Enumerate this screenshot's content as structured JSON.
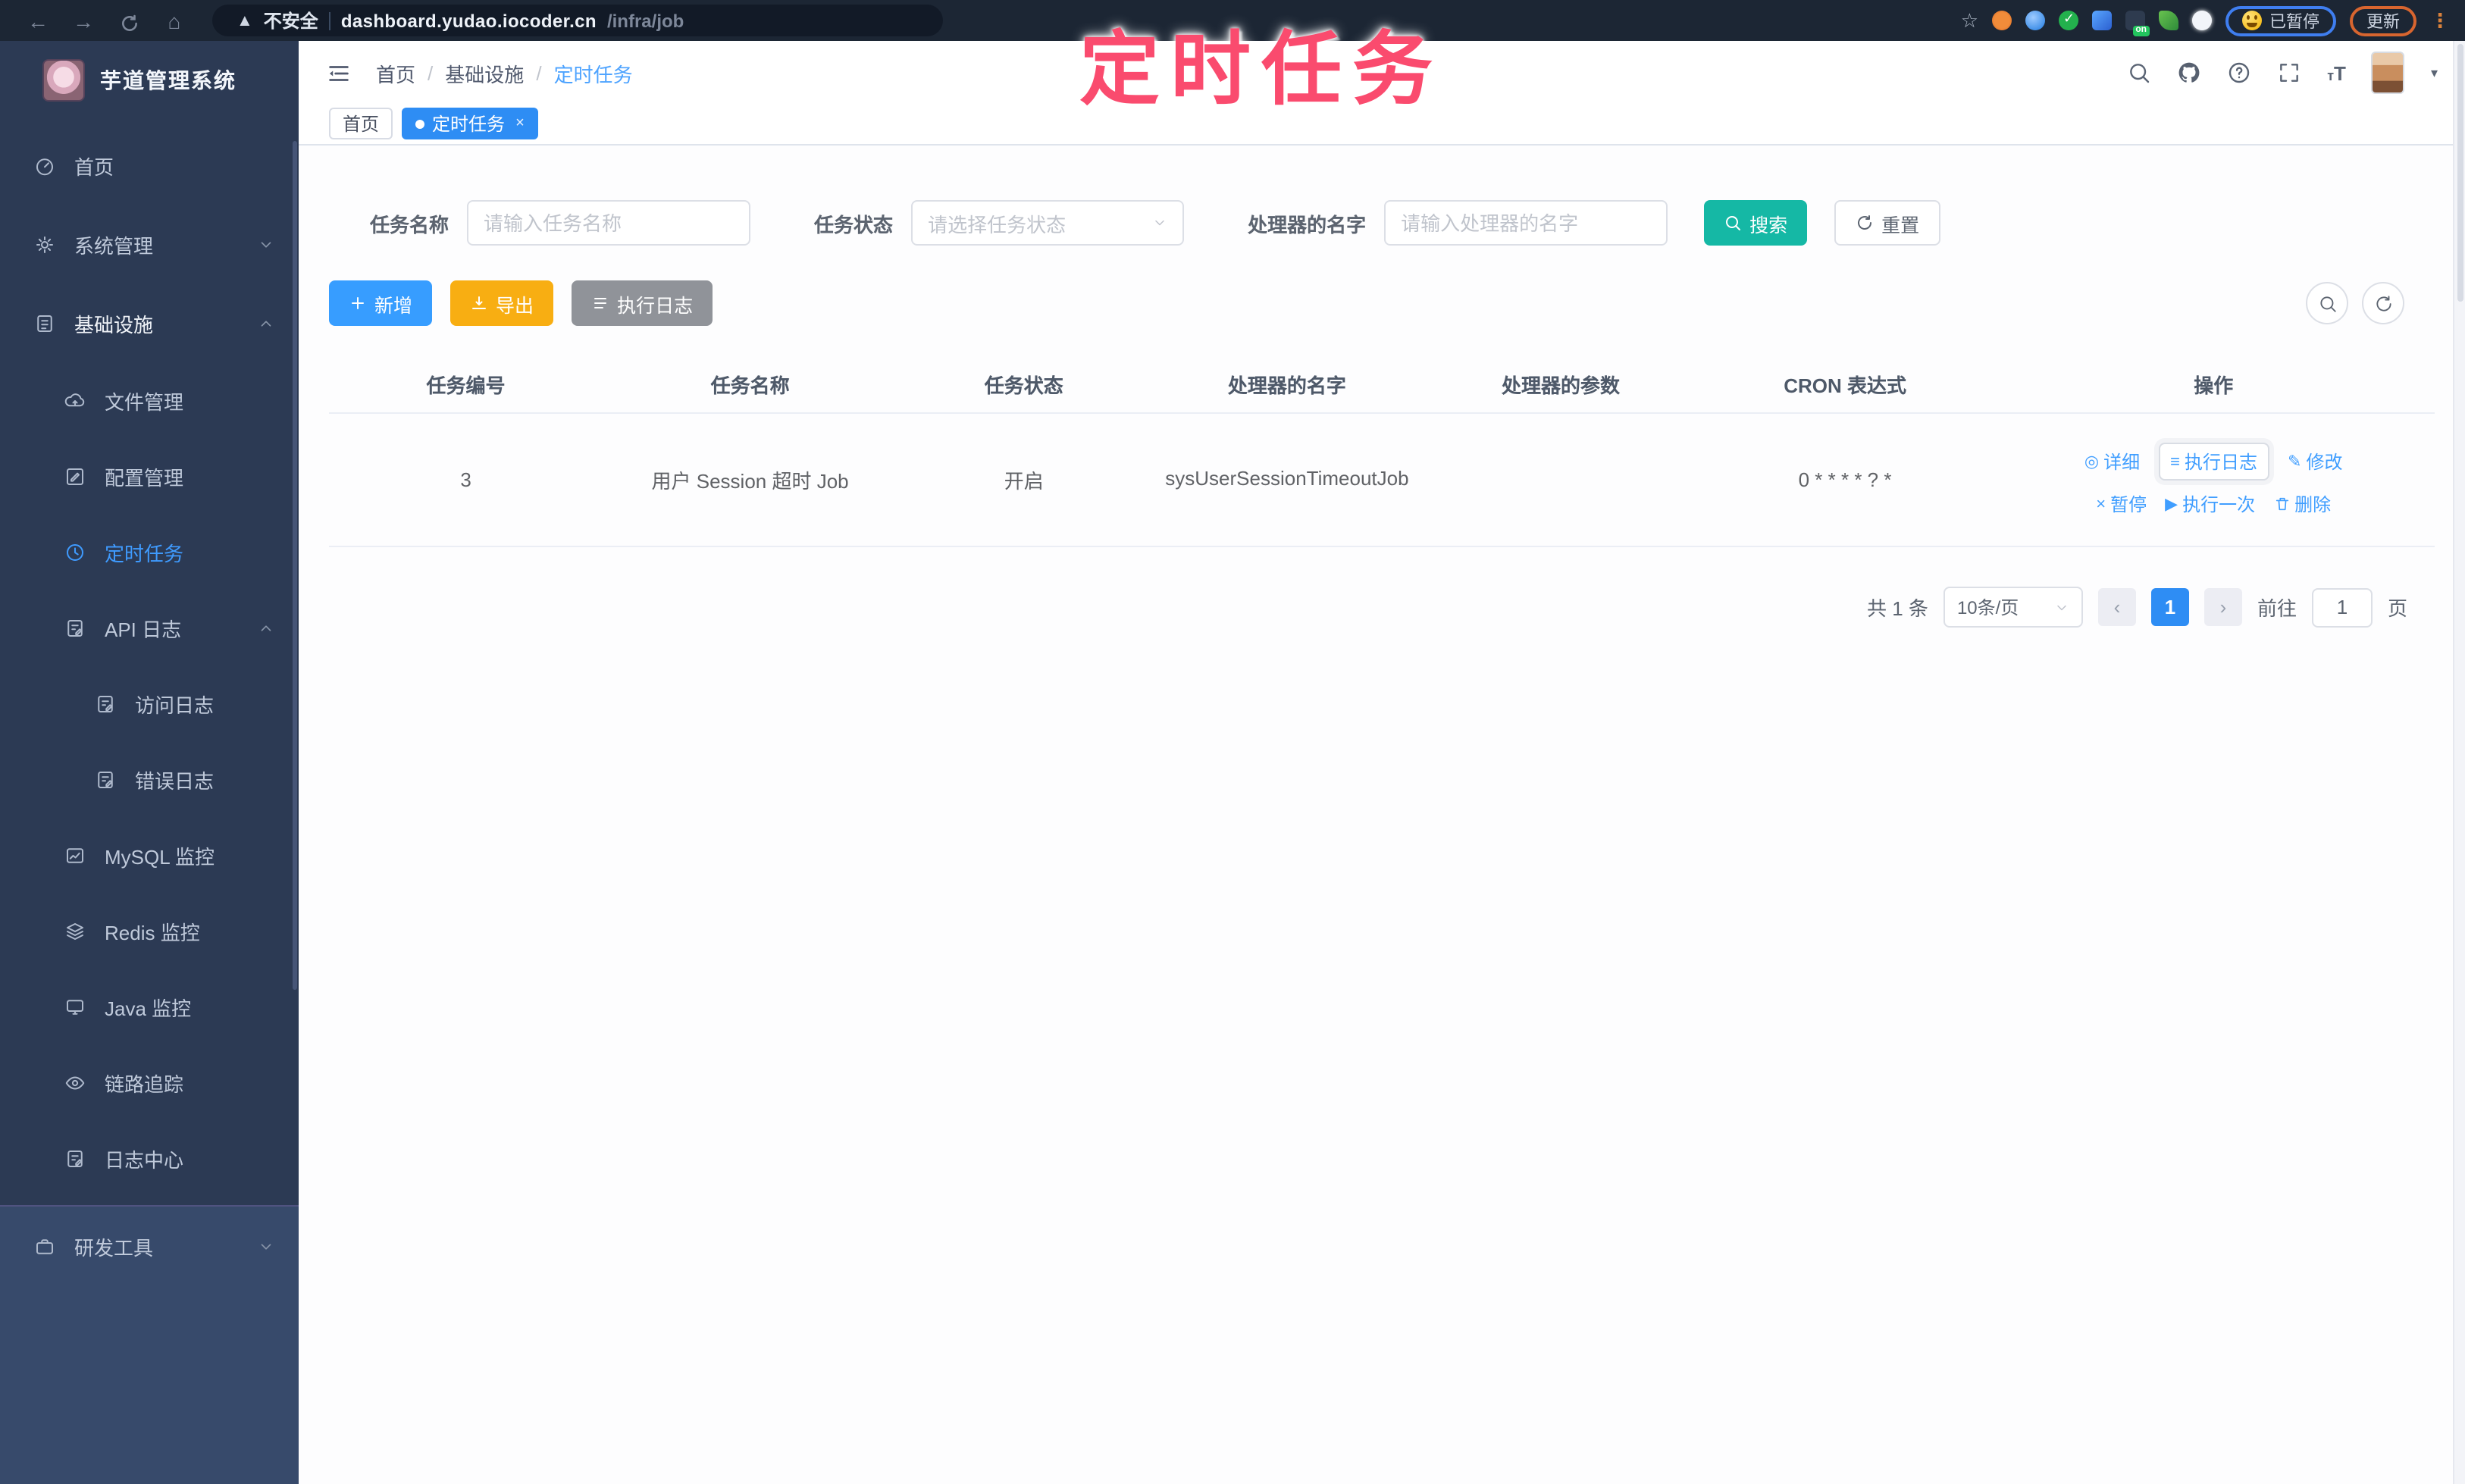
{
  "overlay": {
    "title": "定时任务"
  },
  "browser": {
    "not_secure": "不安全",
    "url_host": "dashboard.yudao.iocoder.cn",
    "url_path": "/infra/job",
    "on_badge": "on",
    "paused_label": "已暂停",
    "update_label": "更新"
  },
  "sidebar": {
    "title": "芋道管理系统",
    "items": [
      {
        "label": "首页"
      },
      {
        "label": "系统管理"
      },
      {
        "label": "基础设施"
      },
      {
        "label": "文件管理"
      },
      {
        "label": "配置管理"
      },
      {
        "label": "定时任务"
      },
      {
        "label": "API 日志"
      },
      {
        "label": "访问日志"
      },
      {
        "label": "错误日志"
      },
      {
        "label": "MySQL 监控"
      },
      {
        "label": "Redis 监控"
      },
      {
        "label": "Java 监控"
      },
      {
        "label": "链路追踪"
      },
      {
        "label": "日志中心"
      },
      {
        "label": "研发工具"
      }
    ]
  },
  "header": {
    "breadcrumb": [
      "首页",
      "基础设施",
      "定时任务"
    ]
  },
  "tabs": [
    {
      "label": "首页"
    },
    {
      "label": "定时任务"
    }
  ],
  "filters": {
    "task_name_label": "任务名称",
    "task_name_placeholder": "请输入任务名称",
    "task_status_label": "任务状态",
    "task_status_placeholder": "请选择任务状态",
    "handler_label": "处理器的名字",
    "handler_placeholder": "请输入处理器的名字",
    "search_label": "搜索",
    "reset_label": "重置"
  },
  "toolbar": {
    "add_label": "新增",
    "export_label": "导出",
    "exec_log_label": "执行日志"
  },
  "table": {
    "columns": [
      "任务编号",
      "任务名称",
      "任务状态",
      "处理器的名字",
      "处理器的参数",
      "CRON 表达式",
      "操作"
    ],
    "row": {
      "id": "3",
      "name": "用户 Session 超时 Job",
      "status": "开启",
      "handler": "sysUserSessionTimeoutJob",
      "params": "",
      "cron": "0 * * * * ? *"
    },
    "ops": {
      "detail": "详细",
      "exec_log": "执行日志",
      "edit": "修改",
      "pause": "暂停",
      "run_once": "执行一次",
      "delete": "删除"
    }
  },
  "pagination": {
    "total": "共 1 条",
    "page_size": "10条/页",
    "page": "1",
    "goto_label": "前往",
    "goto_value": "1",
    "unit": "页"
  },
  "colors": {
    "accent_blue": "#409eff",
    "search_teal": "#15b8a5",
    "export_amber": "#f8ae12",
    "info_gray": "#909399",
    "sidebar_navy": "#2c3a54",
    "overlay_pink": "#fa4b6e"
  }
}
